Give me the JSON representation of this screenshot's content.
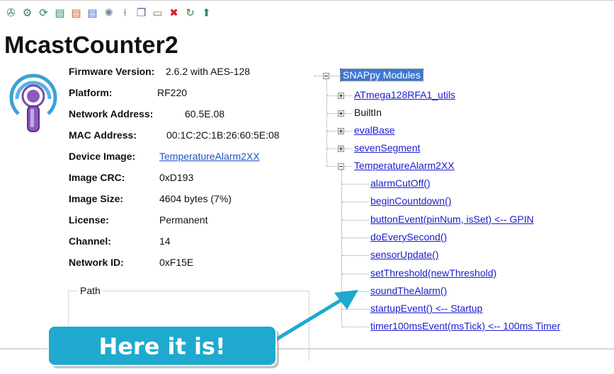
{
  "toolbar": {
    "icons": [
      {
        "name": "broadcast-icon",
        "glyph": "✇",
        "color": "#2e8b57"
      },
      {
        "name": "network-icon",
        "glyph": "⚙",
        "color": "#2e8b57"
      },
      {
        "name": "refresh-icon",
        "glyph": "⟳",
        "color": "#2e8b57"
      },
      {
        "name": "upload-icon",
        "glyph": "▤",
        "color": "#2e8b57"
      },
      {
        "name": "script-upload-icon",
        "glyph": "▤",
        "color": "#d06020"
      },
      {
        "name": "script-erase-icon",
        "glyph": "▤",
        "color": "#3a6fd0"
      },
      {
        "name": "configure-icon",
        "glyph": "✺",
        "color": "#7a8aa0"
      },
      {
        "name": "probe-icon",
        "glyph": "⍿",
        "color": "#777777"
      },
      {
        "name": "copy-icon",
        "glyph": "❐",
        "color": "#4a6a9a"
      },
      {
        "name": "terminal-icon",
        "glyph": "▭",
        "color": "#777777"
      },
      {
        "name": "delete-icon",
        "glyph": "✖",
        "color": "#d92020"
      },
      {
        "name": "reboot-icon",
        "glyph": "↻",
        "color": "#2e8b57"
      },
      {
        "name": "firmware-icon",
        "glyph": "⬆",
        "color": "#2e8b57"
      }
    ]
  },
  "device": {
    "name": "McastCounter2"
  },
  "properties": [
    {
      "label": "Firmware Version:",
      "value": "2.6.2 with AES-128",
      "link": false
    },
    {
      "label": "Platform:",
      "value": "RF220",
      "link": false
    },
    {
      "label": "Network Address:",
      "value": "60.5E.08",
      "link": false
    },
    {
      "label": "MAC Address:",
      "value": "00:1C:2C:1B:26:60:5E:08",
      "link": false
    },
    {
      "label": "Device Image:",
      "value": "TemperatureAlarm2XX",
      "link": true
    },
    {
      "label": "Image CRC:",
      "value": "0xD193",
      "link": false
    },
    {
      "label": "Image Size:",
      "value": "4604 bytes (7%)",
      "link": false
    },
    {
      "label": "License:",
      "value": "Permanent",
      "link": false
    },
    {
      "label": "Channel:",
      "value": "14",
      "link": false
    },
    {
      "label": "Network ID:",
      "value": "0xF15E",
      "link": false
    }
  ],
  "path": {
    "label": "Path"
  },
  "tree": {
    "root": "SNAPpy Modules",
    "modules": [
      {
        "label": "ATmega128RFA1_utils",
        "link": true,
        "expanded": false
      },
      {
        "label": "BuiltIn",
        "link": false,
        "expanded": false
      },
      {
        "label": "evalBase",
        "link": true,
        "expanded": false
      },
      {
        "label": "sevenSegment",
        "link": true,
        "expanded": false
      },
      {
        "label": "TemperatureAlarm2XX",
        "link": true,
        "expanded": true
      }
    ],
    "functions": [
      "alarmCutOff()",
      "beginCountdown()",
      "buttonEvent(pinNum, isSet) <-- GPIN",
      "doEverySecond()",
      "sensorUpdate()",
      "setThreshold(newThreshold)",
      "soundTheAlarm()",
      "startupEvent() <-- Startup",
      "timer100msEvent(msTick) <-- 100ms Timer"
    ]
  },
  "callout": {
    "text": "Here it is!",
    "color": "#1fa9cf"
  }
}
